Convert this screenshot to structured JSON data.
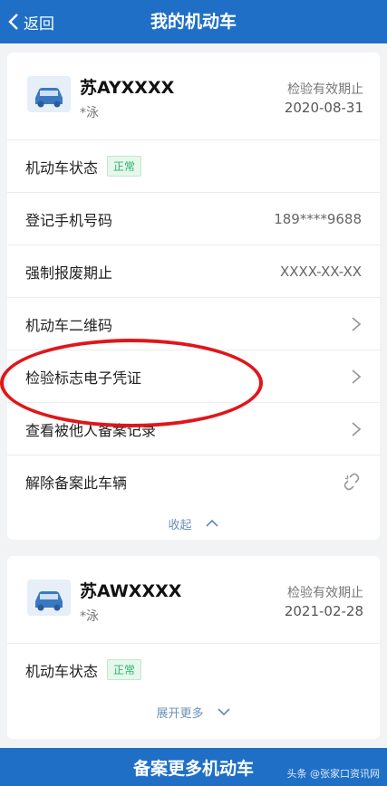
{
  "header": {
    "back_label": "返回",
    "title": "我的机动车"
  },
  "colors": {
    "primary": "#1f6fc6",
    "status_green": "#2bb36a",
    "highlight_red": "#e0161a",
    "link_blue": "#6b8fb8"
  },
  "vehicle1": {
    "plate": "苏AYXXXX",
    "owner": "*泳",
    "expiry_label": "检验有效期止",
    "expiry_date": "2020-08-31",
    "status_label": "机动车状态",
    "status_badge": "正常",
    "phone_label": "登记手机号码",
    "phone_value": "189****9688",
    "scrap_label": "强制报废期止",
    "scrap_value": "XXXX-XX-XX",
    "qr_label": "机动车二维码",
    "certificate_label": "检验标志电子凭证",
    "records_label": "查看被他人备案记录",
    "unbind_label": "解除备案此车辆",
    "collapse_label": "收起"
  },
  "vehicle2": {
    "plate": "苏AWXXXX",
    "owner": "*泳",
    "expiry_label": "检验有效期止",
    "expiry_date": "2021-02-28",
    "status_label": "机动车状态",
    "status_badge": "正常",
    "expand_label": "展开更多"
  },
  "footer": {
    "button_label": "备案更多机动车",
    "watermark": "头条 @张家口资讯网"
  },
  "icons": {
    "back": "chevron-left-icon",
    "car": "car-icon",
    "chevron": "chevron-right-icon",
    "unlink": "unlink-icon",
    "up": "chevron-up-icon",
    "down": "chevron-down-icon"
  }
}
